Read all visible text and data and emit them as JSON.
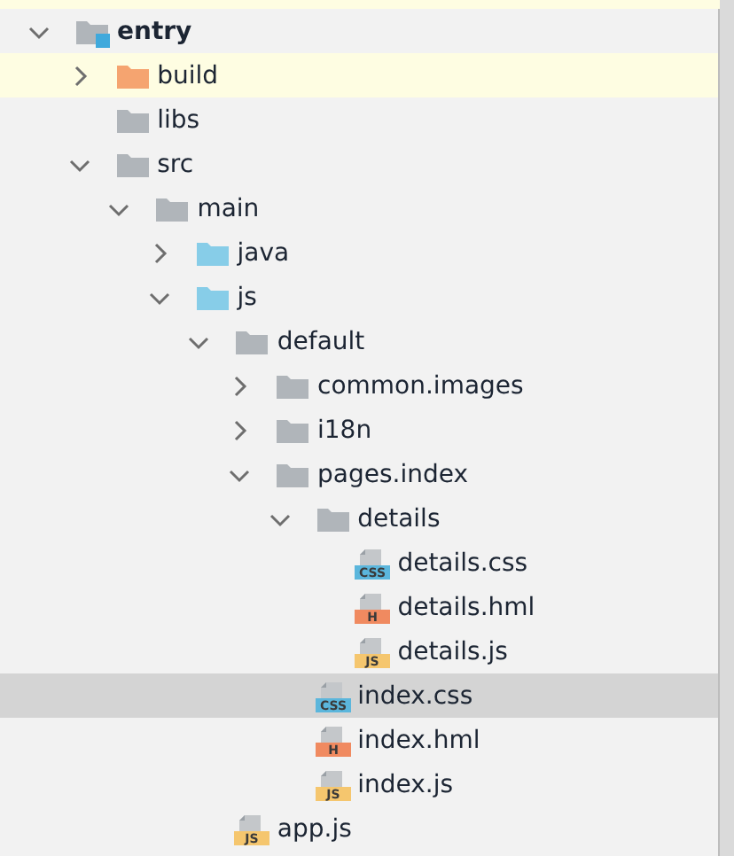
{
  "tree": [
    {
      "name": "entry",
      "kind": "module",
      "expanded": true,
      "selected": false,
      "highlighted": false,
      "children": [
        {
          "name": "build",
          "kind": "output-folder",
          "expanded": false,
          "selected": false,
          "highlighted": true
        },
        {
          "name": "libs",
          "kind": "folder",
          "selected": false,
          "highlighted": false
        },
        {
          "name": "src",
          "kind": "folder",
          "expanded": true,
          "selected": false,
          "highlighted": false,
          "children": [
            {
              "name": "main",
              "kind": "folder",
              "expanded": true,
              "selected": false,
              "highlighted": false,
              "children": [
                {
                  "name": "java",
                  "kind": "source-folder",
                  "expanded": false,
                  "selected": false,
                  "highlighted": false
                },
                {
                  "name": "js",
                  "kind": "source-folder",
                  "expanded": true,
                  "selected": false,
                  "highlighted": false,
                  "children": [
                    {
                      "name": "default",
                      "kind": "folder",
                      "expanded": true,
                      "selected": false,
                      "highlighted": false,
                      "children": [
                        {
                          "name": "common.images",
                          "kind": "folder",
                          "expanded": false,
                          "selected": false,
                          "highlighted": false
                        },
                        {
                          "name": "i18n",
                          "kind": "folder",
                          "expanded": false,
                          "selected": false,
                          "highlighted": false
                        },
                        {
                          "name": "pages.index",
                          "kind": "folder",
                          "expanded": true,
                          "selected": false,
                          "highlighted": false,
                          "children": [
                            {
                              "name": "details",
                              "kind": "folder",
                              "expanded": true,
                              "selected": false,
                              "highlighted": false,
                              "children": [
                                {
                                  "name": "details.css",
                                  "kind": "css",
                                  "badge": "CSS",
                                  "selected": false,
                                  "highlighted": false
                                },
                                {
                                  "name": "details.hml",
                                  "kind": "hml",
                                  "badge": "H",
                                  "selected": false,
                                  "highlighted": false
                                },
                                {
                                  "name": "details.js",
                                  "kind": "js",
                                  "badge": "JS",
                                  "selected": false,
                                  "highlighted": false
                                }
                              ]
                            },
                            {
                              "name": "index.css",
                              "kind": "css",
                              "badge": "CSS",
                              "selected": true,
                              "highlighted": false
                            },
                            {
                              "name": "index.hml",
                              "kind": "hml",
                              "badge": "H",
                              "selected": false,
                              "highlighted": false
                            },
                            {
                              "name": "index.js",
                              "kind": "js",
                              "badge": "JS",
                              "selected": false,
                              "highlighted": false
                            }
                          ]
                        }
                      ]
                    },
                    {
                      "name": "app.js",
                      "kind": "js",
                      "badge": "JS",
                      "selected": false,
                      "highlighted": false
                    }
                  ]
                }
              ]
            }
          ]
        }
      ]
    }
  ]
}
